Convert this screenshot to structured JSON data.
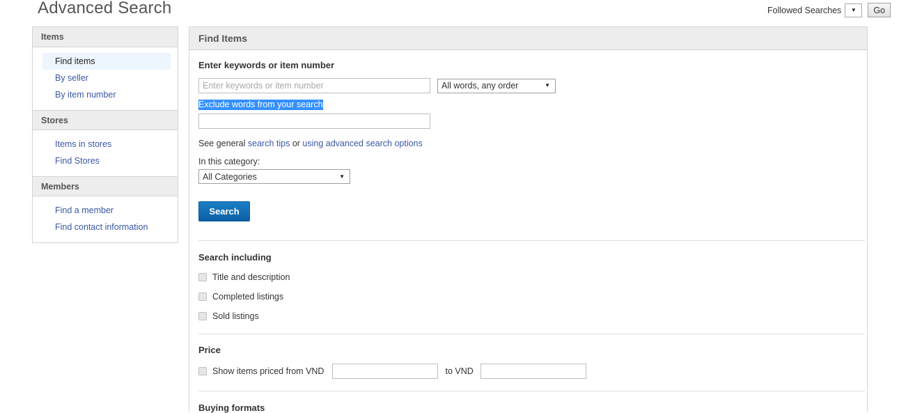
{
  "header": {
    "title": "Advanced Search",
    "followed_searches_label": "Followed Searches",
    "followed_searches_caret": "▼",
    "go_label": "Go"
  },
  "sidebar": {
    "groups": [
      {
        "heading": "Items",
        "links": [
          {
            "label": "Find items",
            "active": true
          },
          {
            "label": "By seller",
            "active": false
          },
          {
            "label": "By item number",
            "active": false
          }
        ]
      },
      {
        "heading": "Stores",
        "links": [
          {
            "label": "Items in stores",
            "active": false
          },
          {
            "label": "Find Stores",
            "active": false
          }
        ]
      },
      {
        "heading": "Members",
        "links": [
          {
            "label": "Find a member",
            "active": false
          },
          {
            "label": "Find contact information",
            "active": false
          }
        ]
      }
    ]
  },
  "panel": {
    "title": "Find Items",
    "keywords": {
      "heading": "Enter keywords or item number",
      "input_placeholder": "Enter keywords or item number",
      "input_value": "",
      "match_select_value": "All words, any order",
      "match_select_caret": "▼",
      "exclude_label": "Exclude words from your search",
      "exclude_input_value": "",
      "tips_prefix": "See general ",
      "tips_link": "search tips",
      "tips_middle": " or ",
      "tips_link2": "using advanced search options",
      "category_label": "In this category:",
      "category_select_value": "All Categories",
      "category_select_caret": "▼",
      "search_button": "Search"
    },
    "search_including": {
      "heading": "Search including",
      "options": [
        {
          "label": "Title and description",
          "checked": false
        },
        {
          "label": "Completed listings",
          "checked": false
        },
        {
          "label": "Sold listings",
          "checked": false
        }
      ]
    },
    "price": {
      "heading": "Price",
      "checkbox_checked": false,
      "from_label": "Show items priced from VND",
      "from_value": "",
      "to_label": "to VND",
      "to_value": ""
    },
    "buying_formats": {
      "heading": "Buying formats"
    }
  },
  "colors": {
    "accent_blue": "#0d5fa6",
    "link_blue": "#3858a5",
    "selection_blue": "#3390ff",
    "panel_header_gray": "#ededed",
    "border_gray": "#d4d4d4"
  }
}
